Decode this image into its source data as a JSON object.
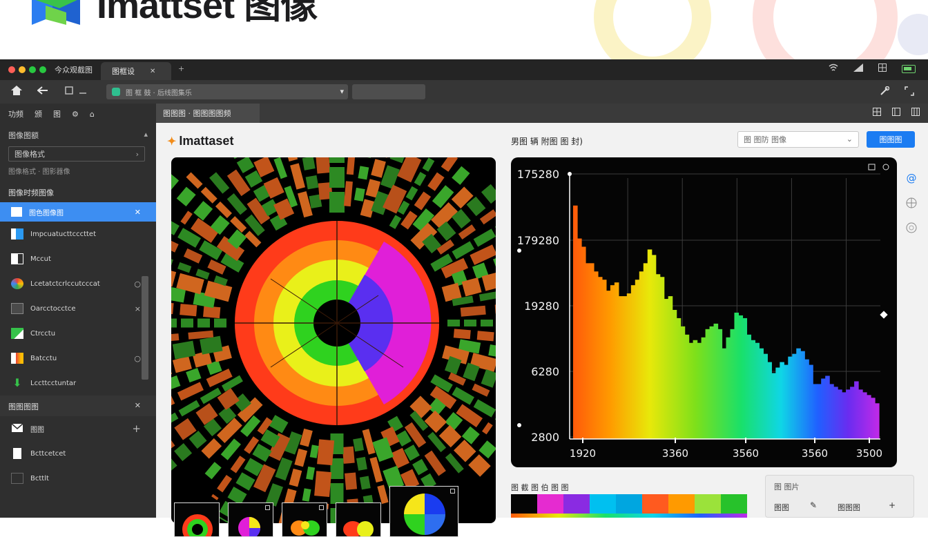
{
  "banner": {
    "brand_name": "Imattset 图像"
  },
  "window": {
    "app_title": "今众观截图",
    "tab_label": "图框设",
    "tab_close": "✕",
    "tab_new": "+",
    "address_text": "图 框 鼓 · 后线图集乐",
    "toolbar_icons": [
      "home-icon",
      "back-icon",
      "window-icon",
      "minimize-icon"
    ]
  },
  "sidebar": {
    "top_items": [
      "功频",
      "颁",
      "图",
      "⚙",
      "⌂"
    ],
    "filter_label": "图像图额",
    "filter_select": "图像格式",
    "filter_sub": "图像格式 · 图影器像",
    "section1": "图像时频图像",
    "items": [
      {
        "label": "图色图像图",
        "icon": "square-icon",
        "active": true,
        "right": "✕"
      },
      {
        "label": "Impcuatucttcccttet",
        "icon": "blue-layer-icon",
        "right": ""
      },
      {
        "label": "Mccut",
        "icon": "mask-icon",
        "right": ""
      },
      {
        "label": "Lcetatctcrlccutcccat",
        "icon": "color-wheel-icon",
        "right": "○"
      },
      {
        "label": "Oarcctocctce",
        "icon": "shape-icon",
        "right": "×"
      },
      {
        "label": "Ctrcctu",
        "icon": "green-tile-icon",
        "right": ""
      },
      {
        "label": "Batcctu",
        "icon": "red-tile-icon",
        "right": "○"
      },
      {
        "label": "Lccttcctuntar",
        "icon": "green-arrow-icon",
        "right": ""
      }
    ],
    "section2": "图图图图",
    "section2_action": "✕",
    "items2": [
      {
        "label": "图图",
        "icon": "envelope-icon",
        "right": "+"
      },
      {
        "label": "Bcttcetcet",
        "icon": "page-icon",
        "right": ""
      },
      {
        "label": "Bcttlt",
        "icon": "image-icon",
        "right": ""
      }
    ]
  },
  "content": {
    "tab_label": "图图图 · 图图图图频",
    "logo_text": "Imattaset",
    "chart_title": "男图 辆 附图 图 封)",
    "dropdown_value": "图 图防 图像",
    "primary_button": "图图图",
    "palette_title": "图 截 图 伯 图 图",
    "info_card": {
      "title": "图 图片",
      "label1": "图图",
      "label2": "图图图",
      "icon1": "✎",
      "icon2": "+"
    }
  },
  "chart_data": {
    "type": "bar",
    "yticks": [
      "175280",
      "179280",
      "19280",
      "6280",
      "2800"
    ],
    "xticks": [
      "1920",
      "3360",
      "3560",
      "3560",
      "3500"
    ],
    "values": [
      170,
      146,
      140,
      128,
      128,
      122,
      118,
      116,
      108,
      112,
      114,
      104,
      104,
      106,
      112,
      116,
      122,
      128,
      138,
      134,
      120,
      118,
      102,
      104,
      94,
      88,
      82,
      76,
      70,
      72,
      70,
      74,
      80,
      82,
      84,
      80,
      66,
      74,
      80,
      92,
      90,
      88,
      76,
      72,
      70,
      66,
      62,
      56,
      48,
      52,
      56,
      54,
      60,
      62,
      66,
      64,
      58,
      54,
      40,
      40,
      44,
      46,
      40,
      38,
      36,
      34,
      36,
      38,
      42,
      36,
      34,
      32,
      30,
      26
    ],
    "ylim": [
      0,
      190
    ]
  },
  "colors": {
    "accent": "#3d8ef2",
    "primary_button": "#1b7cf2",
    "sidebar_bg": "#2f2f2f",
    "chart_bg": "#050505"
  },
  "palette": [
    "#050505",
    "#e52bd0",
    "#8a2be2",
    "#00c0f0",
    "#00a6e0",
    "#ff5a1f",
    "#ff9a00",
    "#9be23a",
    "#27c22b"
  ]
}
